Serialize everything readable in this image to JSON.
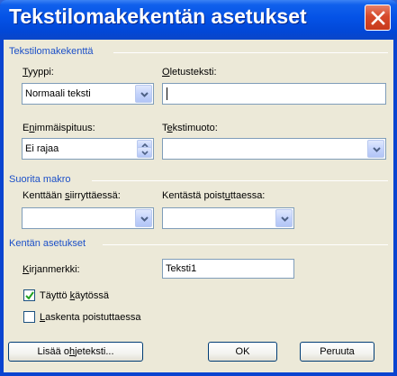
{
  "window": {
    "title": "Tekstilomakekentän asetukset"
  },
  "sections": {
    "form_field": "Tekstilomakekenttä",
    "run_macro": "Suorita makro",
    "field_settings": "Kentän asetukset"
  },
  "type": {
    "label_pre": "",
    "label_ul": "T",
    "label_post": "yyppi:",
    "value": "Normaali teksti"
  },
  "default_text": {
    "label_pre": "",
    "label_ul": "O",
    "label_post": "letusteksti:",
    "value": ""
  },
  "max_length": {
    "label_pre": "E",
    "label_ul": "n",
    "label_post": "immäispituus:",
    "value": "Ei rajaa"
  },
  "text_format": {
    "label_pre": "T",
    "label_ul": "e",
    "label_post": "kstimuoto:",
    "value": ""
  },
  "on_entry": {
    "label_pre": "Kenttään ",
    "label_ul": "s",
    "label_post": "iirryttäessä:",
    "value": ""
  },
  "on_exit": {
    "label_pre": "Kentästä poist",
    "label_ul": "u",
    "label_post": "ttaessa:",
    "value": ""
  },
  "bookmark": {
    "label_pre": "",
    "label_ul": "K",
    "label_post": "irjanmerkki:",
    "value": "Teksti1"
  },
  "fill_in_enabled": {
    "label_pre": "Täyttö ",
    "label_ul": "k",
    "label_post": "äytössä",
    "checked": true
  },
  "calculate_on_exit": {
    "label_pre": "",
    "label_ul": "L",
    "label_post": "askenta poistuttaessa",
    "checked": false
  },
  "buttons": {
    "help_pre": "Lisää o",
    "help_ul": "h",
    "help_post": "jeteksti...",
    "ok": "OK",
    "cancel": "Peruuta"
  },
  "colors": {
    "section_title": "#1c50c8",
    "titlebar": "#0452e6",
    "close": "#d6492a"
  }
}
